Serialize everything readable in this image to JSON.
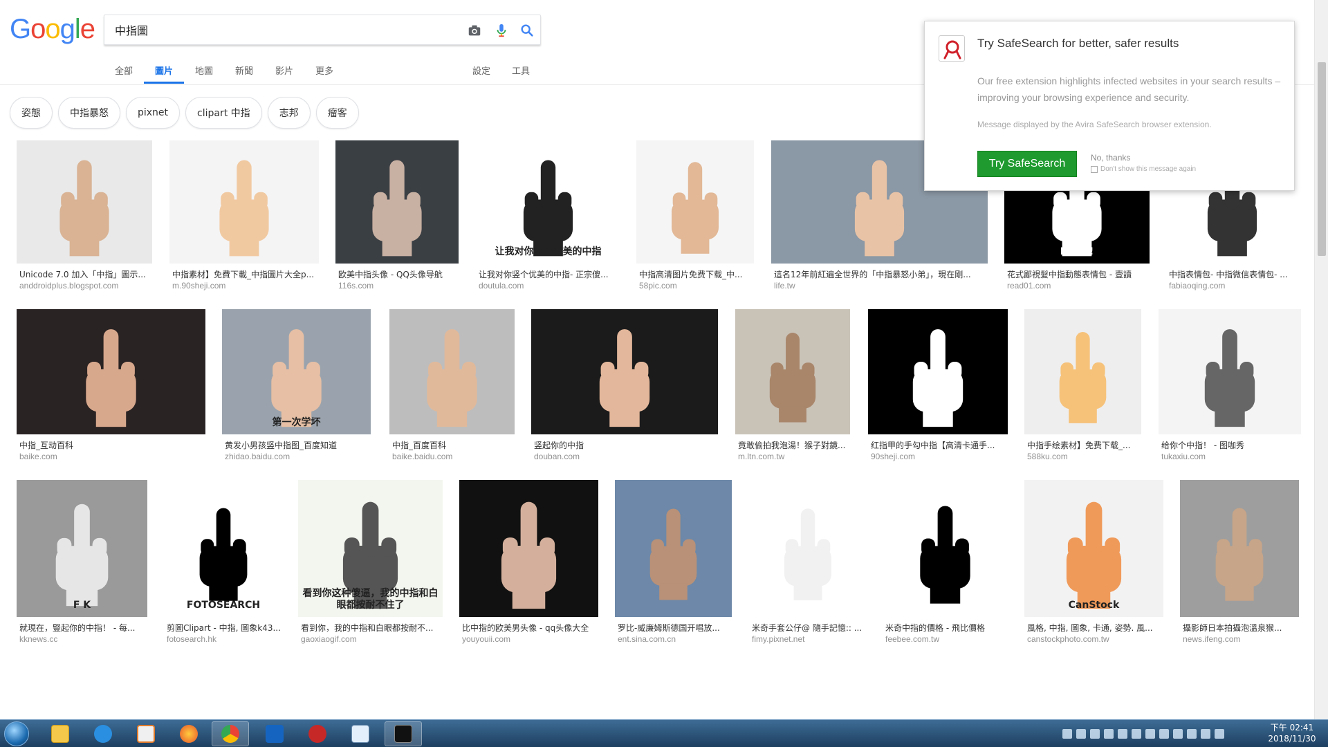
{
  "header": {
    "logo_letters": [
      {
        "char": "G",
        "color": "#4285f4"
      },
      {
        "char": "o",
        "color": "#ea4335"
      },
      {
        "char": "o",
        "color": "#fbbc05"
      },
      {
        "char": "g",
        "color": "#4285f4"
      },
      {
        "char": "l",
        "color": "#34a853"
      },
      {
        "char": "e",
        "color": "#ea4335"
      }
    ],
    "search_value": "中指圖",
    "tabs": [
      {
        "label": "全部",
        "active": false
      },
      {
        "label": "圖片",
        "active": true
      },
      {
        "label": "地圖",
        "active": false
      },
      {
        "label": "新聞",
        "active": false
      },
      {
        "label": "影片",
        "active": false
      },
      {
        "label": "更多",
        "active": false
      }
    ],
    "settings_label": "設定",
    "tools_label": "工具"
  },
  "chips": [
    "姿態",
    "中指暴怒",
    "pixnet",
    "clipart 中指",
    "志邦",
    "瘤客"
  ],
  "results": [
    [
      {
        "title": "Unicode 7.0 加入「中指」圖示...",
        "site": "anddroidplus.blogspot.com"
      },
      {
        "title": "中指素材】免費下載_中指圖片大全p...",
        "site": "m.90sheji.com"
      },
      {
        "title": "欧美中指头像 - QQ头像导航",
        "site": "116s.com"
      },
      {
        "title": "让我对你竖个优美的中指- 正宗傻...",
        "site": "doutula.com",
        "caption": "让我对你竖个优美的中指"
      },
      {
        "title": "中指高清图片免费下载_中...",
        "site": "58pic.com"
      },
      {
        "title": "這名12年前紅遍全世界的「中指暴怒小弟」，現在剛...",
        "site": "life.tw"
      },
      {
        "title": "花式鄙視髮中指動態表情包 - 壹讀",
        "site": "read01.com",
        "caption": "FUCK!"
      },
      {
        "title": "中指表情包- 中指微信表情包- ...",
        "site": "fabiaoqing.com"
      }
    ],
    [
      {
        "title": "中指_互动百科",
        "site": "baike.com"
      },
      {
        "title": "黄发小男孩竖中指图_百度知道",
        "site": "zhidao.baidu.com",
        "caption": "第一次学坏"
      },
      {
        "title": "中指_百度百科",
        "site": "baike.baidu.com"
      },
      {
        "title": "竖起你的中指",
        "site": "douban.com"
      },
      {
        "title": "竟敢偷拍我泡湯！猴子對鏡...",
        "site": "m.ltn.com.tw"
      },
      {
        "title": "红指甲的手勾中指【高清卡通手...",
        "site": "90sheji.com"
      },
      {
        "title": "中指手绘素材】免费下载_...",
        "site": "588ku.com"
      },
      {
        "title": "给你个中指！ - 图咖秀",
        "site": "tukaxiu.com"
      }
    ],
    [
      {
        "title": "就現在，豎起你的中指！ - 每...",
        "site": "kknews.cc",
        "caption": "F K"
      },
      {
        "title": "剪圖Clipart - 中指, 圖象k43...",
        "site": "fotosearch.hk",
        "caption": "FOTOSEARCH"
      },
      {
        "title": "看到你，我的中指和白眼都按耐不...",
        "site": "gaoxiaogif.com",
        "caption": "看到你这种傻逼，我的中指和白眼都按耐不住了"
      },
      {
        "title": "比中指的欧美男头像 - qq头像大全",
        "site": "youyouii.com"
      },
      {
        "title": "罗比-威廉姆斯德国开唱放...",
        "site": "ent.sina.com.cn"
      },
      {
        "title": "米奇手套公仔@ 隨手記憶:: ...",
        "site": "fimy.pixnet.net"
      },
      {
        "title": "米奇中指的價格 - 飛比價格",
        "site": "feebee.com.tw"
      },
      {
        "title": "風格, 中指, 圖象, 卡通, 姿勢. 風...",
        "site": "canstockphoto.com.tw",
        "caption": "CanStock"
      },
      {
        "title": "攝影師日本拍攝泡溫泉猴...",
        "site": "news.ifeng.com"
      }
    ]
  ],
  "popup": {
    "title": "Try SafeSearch for better, safer results",
    "body": "Our free extension highlights infected websites in your search results – improving your browsing experience and security.",
    "note": "Message displayed by the Avira SafeSearch browser extension.",
    "button": "Try SafeSearch",
    "no_thanks": "No, thanks",
    "dont_show": "Don't show this message again",
    "button_color": "#1e9a2f"
  },
  "taskbar": {
    "apps": [
      "start-orb",
      "file-explorer",
      "internet-explorer",
      "media-player",
      "firefox",
      "chrome",
      "outlook",
      "network-globe",
      "notepad",
      "terminal"
    ],
    "time": "下午 02:41",
    "date": "2018/11/30"
  }
}
